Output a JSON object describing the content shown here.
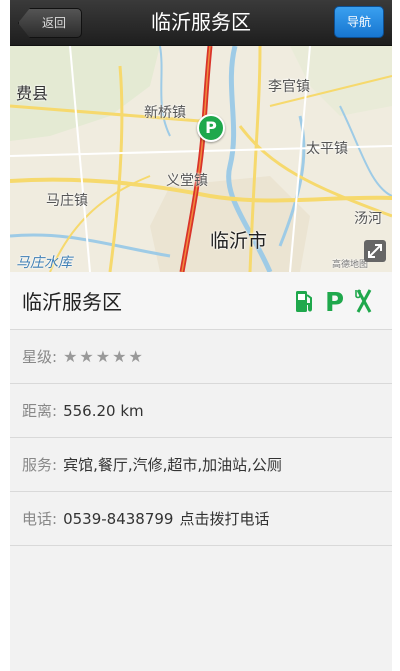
{
  "nav": {
    "back_label": "返回",
    "title": "临沂服务区",
    "navigate_label": "导航"
  },
  "map": {
    "labels": {
      "feixian": "费县",
      "liguanzhen": "李官镇",
      "xinqiaozhen": "新桥镇",
      "taipingzhen": "太平镇",
      "yitangzhen": "义堂镇",
      "mazhuangzhen": "马庄镇",
      "tanghe": "汤河",
      "linyishi": "临沂市",
      "reservoir": "马庄水库",
      "provider": "高德地图"
    },
    "marker_glyph": "P"
  },
  "place": {
    "name": "临沂服务区",
    "amenities": [
      "gas-station",
      "parking",
      "restaurant"
    ],
    "parking_glyph": "P",
    "accent": "#1fa84c"
  },
  "details": {
    "rating_label": "星级:",
    "rating_stars": 5,
    "rating_glyphs": "★★★★★",
    "distance_label": "距离:",
    "distance_value": "556.20 km",
    "services_label": "服务:",
    "services_value": "宾馆,餐厅,汽修,超市,加油站,公厕",
    "phone_label": "电话:",
    "phone_value": "0539-8438799",
    "call_label": "点击拨打电话"
  }
}
